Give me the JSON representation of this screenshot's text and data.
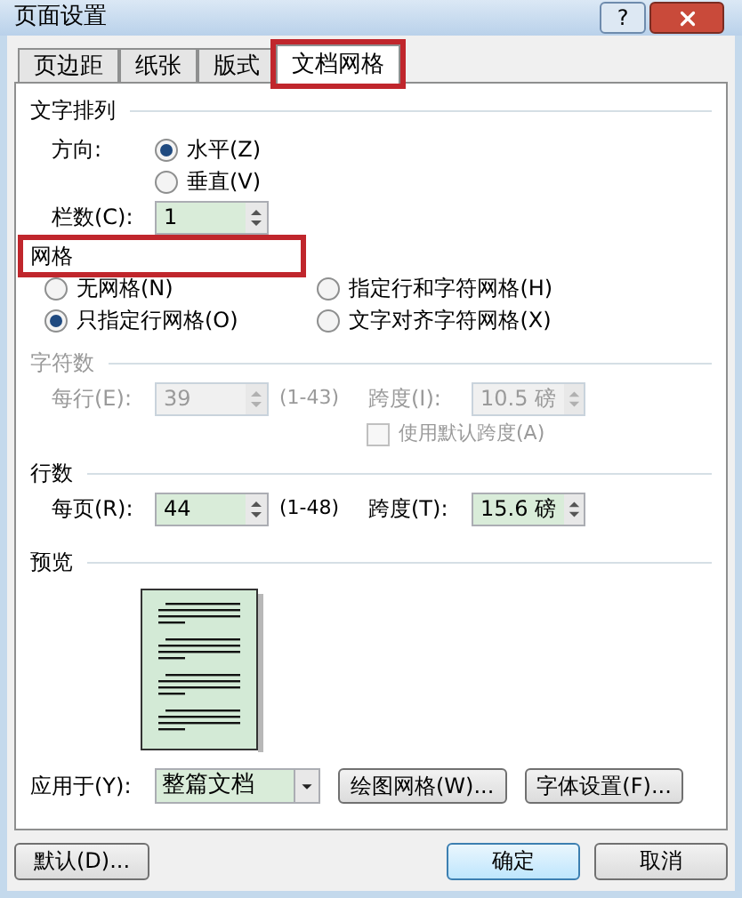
{
  "window": {
    "title": "页面设置",
    "help": "?"
  },
  "tabs": [
    {
      "label": "页边距",
      "selected": false,
      "highlighted": false
    },
    {
      "label": "纸张",
      "selected": false,
      "highlighted": false
    },
    {
      "label": "版式",
      "selected": false,
      "highlighted": false
    },
    {
      "label": "文档网格",
      "selected": true,
      "highlighted": true
    }
  ],
  "text_direction": {
    "title": "文字排列",
    "direction_label": "方向:",
    "options": [
      {
        "label": "水平(Z)",
        "selected": true
      },
      {
        "label": "垂直(V)",
        "selected": false
      }
    ],
    "columns_label": "栏数(C):",
    "columns_value": "1"
  },
  "grid": {
    "title": "网格",
    "highlighted": true,
    "options": [
      {
        "label": "无网格(N)",
        "selected": false
      },
      {
        "label": "只指定行网格(O)",
        "selected": true
      },
      {
        "label": "指定行和字符网格(H)",
        "selected": false
      },
      {
        "label": "文字对齐字符网格(X)",
        "selected": false
      }
    ]
  },
  "characters": {
    "title": "字符数",
    "disabled": true,
    "count_label": "每行(E):",
    "count_value": "39",
    "range": "(1-43)",
    "pitch_label": "跨度(I):",
    "pitch_value": "10.5 磅",
    "default_pitch": {
      "label": "使用默认跨度(A)",
      "checked": false
    }
  },
  "lines": {
    "title": "行数",
    "disabled": false,
    "count_label": "每页(R):",
    "count_value": "44",
    "range": "(1-48)",
    "pitch_label": "跨度(T):",
    "pitch_value": "15.6 磅"
  },
  "preview": {
    "title": "预览"
  },
  "apply_to": {
    "label": "应用于(Y):",
    "value": "整篇文档"
  },
  "panel_buttons": [
    "绘图网格(W)...",
    "字体设置(F)..."
  ],
  "footer_buttons": [
    "默认(D)...",
    "确定",
    "取消"
  ]
}
